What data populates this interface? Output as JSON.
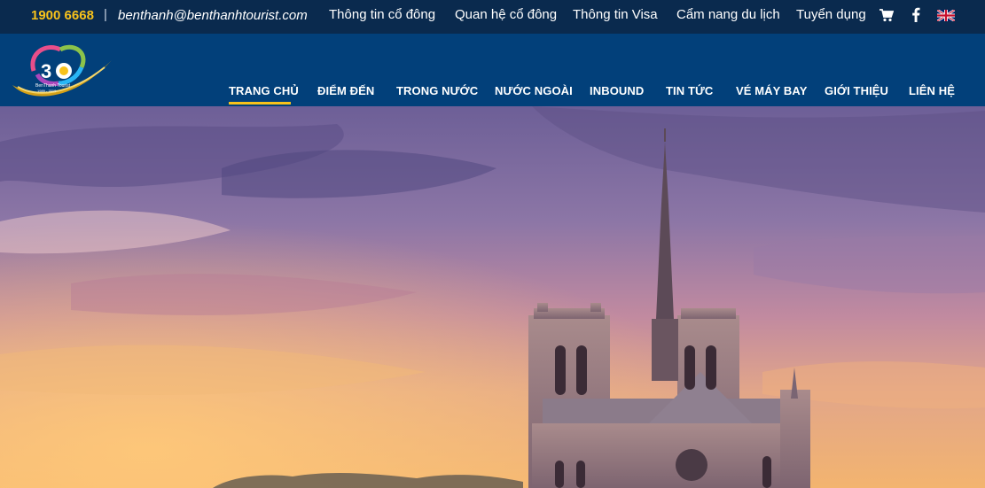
{
  "topbar": {
    "hotline": "1900 6668",
    "separator": "|",
    "email": "benthanh@benthanhtourist.com",
    "links": [
      "Thông tin cổ đông",
      "Quan hệ cổ đông",
      "Thông tin Visa",
      "Cẩm nang du lịch",
      "Tuyển dụng"
    ],
    "icons": [
      "cart-icon",
      "facebook-icon",
      "uk-flag-icon"
    ],
    "colors": {
      "background": "#0a2a4e",
      "hotline": "#f7c21b"
    }
  },
  "header": {
    "logo": {
      "brand_text": "BenThanh Tourist",
      "years": "1989 - 2019",
      "number": "30"
    },
    "nav": [
      "TRANG CHỦ",
      "ĐIỂM ĐẾN",
      "TRONG NƯỚC",
      "NƯỚC NGOÀI",
      "INBOUND",
      "TIN TỨC",
      "VÉ MÁY BAY",
      "GIỚI THIỆU",
      "LIÊN HỆ"
    ],
    "active_nav": "TRANG CHỦ",
    "colors": {
      "background": "#02407a",
      "accent": "#f7c21b"
    }
  },
  "hero": {
    "scene": "notre-dame-sunset"
  }
}
